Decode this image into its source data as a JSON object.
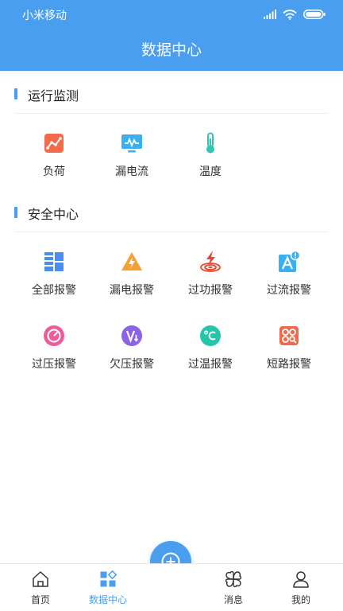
{
  "status_bar": {
    "carrier": "小米移动",
    "icons": [
      "signal-icon",
      "wifi-icon",
      "battery-icon"
    ]
  },
  "header": {
    "title": "数据中心"
  },
  "sections": [
    {
      "title": "运行监测",
      "items": [
        {
          "label": "负荷",
          "icon": "load-chart-icon",
          "color": "#f26b4a"
        },
        {
          "label": "漏电流",
          "icon": "monitor-wave-icon",
          "color": "#3ab0f2"
        },
        {
          "label": "温度",
          "icon": "thermometer-icon",
          "color": "#2ec7b4"
        }
      ]
    },
    {
      "title": "安全中心",
      "items": [
        {
          "label": "全部报警",
          "icon": "grid-list-icon",
          "color": "#4a8ef0"
        },
        {
          "label": "漏电报警",
          "icon": "warning-triangle-icon",
          "color": "#f5a033"
        },
        {
          "label": "过功报警",
          "icon": "lightning-target-icon",
          "color": "#e8452c"
        },
        {
          "label": "过流报警",
          "icon": "current-alert-icon",
          "color": "#3ab0f2"
        },
        {
          "label": "过压报警",
          "icon": "gauge-icon",
          "color": "#f05a9a"
        },
        {
          "label": "欠压报警",
          "icon": "undervoltage-icon",
          "color": "#8c62e8"
        },
        {
          "label": "过温报警",
          "icon": "celsius-icon",
          "color": "#25c4ab"
        },
        {
          "label": "短路报警",
          "icon": "short-circuit-icon",
          "color": "#f06a4a"
        }
      ]
    }
  ],
  "tabbar": {
    "tabs": [
      {
        "label": "首页",
        "icon": "home-icon",
        "active": false
      },
      {
        "label": "数据中心",
        "icon": "data-center-icon",
        "active": true
      },
      {
        "label": "消息",
        "icon": "message-clover-icon",
        "active": false
      },
      {
        "label": "我的",
        "icon": "user-icon",
        "active": false
      }
    ],
    "fab_icon": "plus-circle-icon"
  },
  "colors": {
    "primary": "#4a9ef0",
    "active_tab": "#4a9ef0",
    "text": "#333333"
  }
}
